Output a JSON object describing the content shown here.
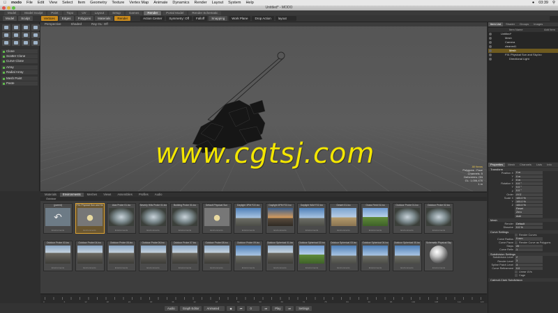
{
  "menubar": {
    "app": "modo",
    "items": [
      "File",
      "Edit",
      "View",
      "Select",
      "Item",
      "Geometry",
      "Texture",
      "Vertex Map",
      "Animate",
      "Dynamics",
      "Render",
      "Layout",
      "System",
      "Help"
    ],
    "clock": "03:39"
  },
  "window": {
    "title": "Untitled* - MODO"
  },
  "layout_tabs": [
    "Model",
    "Model Sculpt",
    "Paint",
    "Topo",
    "UV",
    "Layout",
    "Setup",
    "Games",
    "Render",
    "Portal Model",
    "Render Schematic"
  ],
  "layout_tab_active": "Render",
  "toolbar": {
    "model": "Model",
    "sculpt": "Sculpt",
    "vertices": "Vertices",
    "edges": "Edges",
    "polygons": "Polygons",
    "materials": "Materials",
    "render": "Render",
    "action_center": "Action Center",
    "symmetry": "Symmetry: Off",
    "falloff": "Falloff",
    "snapping": "Snapping",
    "work_plane": "Work Plane",
    "drop_action": "Drop Action",
    "layout": "layout"
  },
  "toolbox": {
    "group1": [
      "Clone",
      "Scatter Clone",
      "Curve Clone"
    ],
    "group2": [
      "Array",
      "Radial Array"
    ],
    "group3": [
      "Mesh Paint",
      "Paste"
    ]
  },
  "viewport": {
    "tabs": [
      "Perspective",
      "Shaded",
      "Ray GL: Off"
    ],
    "info": [
      "All Items",
      "Polygons : Face",
      "Channels: 5",
      "Deformers: ON",
      "GL: 1,006,476",
      "1 m"
    ],
    "watermark": "www.cgtsj.com"
  },
  "items_panel": {
    "tabs": [
      "Item List",
      "Shader",
      "Groups",
      "Images"
    ],
    "header_left": "Item Name",
    "header_right": "Add Item",
    "rows": [
      {
        "label": "Untitled*",
        "indent": 18,
        "sel": false
      },
      {
        "label": "Mesh",
        "indent": 24,
        "sel": false
      },
      {
        "label": "Camera",
        "indent": 24,
        "sel": false
      },
      {
        "label": "cleaned1",
        "indent": 24,
        "sel": false
      },
      {
        "label": "Mesh",
        "indent": 30,
        "sel": true
      },
      {
        "label": "F51 Physical Sun and Sky.lxo",
        "indent": 24,
        "sel": false
      },
      {
        "label": "Directional Light",
        "indent": 30,
        "sel": false
      }
    ]
  },
  "properties": {
    "tabs": [
      "Properties",
      "Mesh",
      "Channels",
      "Lists",
      "Info"
    ],
    "transform": "Transform",
    "rows": [
      {
        "label": "Position X",
        "value": "0 m"
      },
      {
        "label": "Y",
        "value": "0 m"
      },
      {
        "label": "Z",
        "value": "0 m"
      },
      {
        "label": "Rotation X",
        "value": "0.0 °"
      },
      {
        "label": "Y",
        "value": "0.0 °"
      },
      {
        "label": "Z",
        "value": "0.0 °"
      },
      {
        "label": "Order",
        "value": "XYZ"
      },
      {
        "label": "Scale X",
        "value": "100.0 %"
      },
      {
        "label": "Y",
        "value": "100.0 %"
      },
      {
        "label": "Z",
        "value": "100.0 %"
      },
      {
        "label": "",
        "value": "Reset"
      },
      {
        "label": "",
        "value": "Zero"
      },
      {
        "label": "",
        "value": "Add"
      }
    ],
    "mesh": "Mesh",
    "mesh_rows": [
      {
        "label": "Render",
        "value": "Default"
      },
      {
        "label": "Dissolve",
        "value": "0.0 %"
      }
    ],
    "curve_settings": "Curve Settings",
    "curve_rows": [
      {
        "label": "",
        "value": "Render Curves",
        "check": true
      },
      {
        "label": "Curve Radius",
        "value": "5 mm"
      },
      {
        "label": "Curve Pacm",
        "value": "Render Curve as Polygons",
        "check": true
      },
      {
        "label": "Steps",
        "value": "20"
      },
      {
        "label": "Curve Refin",
        "value": "1"
      }
    ],
    "subdivision": "Subdivision Settings",
    "subdiv_rows": [
      {
        "label": "Subdivision Level",
        "value": "2"
      },
      {
        "label": "Render Level",
        "value": "3"
      },
      {
        "label": "Spline Patch Level",
        "value": "3"
      },
      {
        "label": "Curve Refinement",
        "value": "0.0"
      },
      {
        "label": "",
        "value": "Linear UVs",
        "check": true
      },
      {
        "label": "",
        "value": "Cage",
        "check": true
      }
    ],
    "catmull": "Catmull-Clark Subdivision"
  },
  "browser": {
    "tabs": [
      "Materials",
      "Environments",
      "Meshes",
      "Views",
      "Assemblies",
      "Profiles",
      "Audio"
    ],
    "active_tab": "Environments",
    "path": "Outdoor",
    "thumbs": [
      {
        "label": "(parent)",
        "kind": "parent",
        "foot": "Environments"
      },
      {
        "label": "F51 Physical Sun and Sk",
        "kind": "light",
        "foot": "Environments",
        "sel": true
      },
      {
        "label": "Alva Probe 01.lxo",
        "kind": "sphere",
        "foot": "Environments"
      },
      {
        "label": "Beverly Hills Probe 01.lxo",
        "kind": "sphere",
        "foot": "Environments"
      },
      {
        "label": "Building Probe 01.lxo",
        "kind": "sphere",
        "foot": "Environments"
      },
      {
        "label": "Default Physical Sun",
        "kind": "light",
        "foot": "Environments"
      },
      {
        "label": "Daylight 3PM F22.lxo",
        "kind": "sky",
        "foot": "Environments"
      },
      {
        "label": "Daylight 6PM F22.lxo",
        "kind": "sunset",
        "foot": "Environments"
      },
      {
        "label": "Daylight 9AM F22.lxo",
        "kind": "sky",
        "foot": "Environments"
      },
      {
        "label": "Desert 01.lxo",
        "kind": "desert",
        "foot": "Environments"
      },
      {
        "label": "Grass Field 01.lxo",
        "kind": "grass",
        "foot": "Environments"
      },
      {
        "label": "Outdoor Probe 01.lxo",
        "kind": "sphere",
        "foot": "Environments"
      },
      {
        "label": "Outdoor Probe 02.lxo",
        "kind": "sphere",
        "foot": "Environments"
      },
      {
        "label": "Outdoor Probe 03.lxo",
        "kind": "street",
        "foot": "Environments"
      },
      {
        "label": "Outdoor Probe 04.lxo",
        "kind": "street",
        "foot": "Environments"
      },
      {
        "label": "Outdoor Probe 05.lxo",
        "kind": "street",
        "foot": "Environments"
      },
      {
        "label": "Outdoor Probe 06.lxo",
        "kind": "street",
        "foot": "Environments"
      },
      {
        "label": "Outdoor Probe 07.lxo",
        "kind": "street",
        "foot": "Environments"
      },
      {
        "label": "Outdoor Probe 08.lxo",
        "kind": "street",
        "foot": "Environments"
      },
      {
        "label": "Outdoor Probe 09.lxo",
        "kind": "sky",
        "foot": "Environments"
      },
      {
        "label": "Outdoor Spherical 01.lxo",
        "kind": "street",
        "foot": "Environments"
      },
      {
        "label": "Outdoor Spherical 02.lxo",
        "kind": "grass",
        "foot": "Environments"
      },
      {
        "label": "Outdoor Spherical 03.lxo",
        "kind": "sky",
        "foot": "Environments"
      },
      {
        "label": "Outdoor Spherical 04.lxo",
        "kind": "sky",
        "foot": "Environments"
      },
      {
        "label": "Outdoor Spherical 05.lxo",
        "kind": "sky",
        "foot": "Environments"
      },
      {
        "label": "Schematic Physical Sky",
        "kind": "ball",
        "foot": "Environments"
      }
    ]
  },
  "timeline": {
    "ticks": [
      "0",
      "6",
      "12",
      "18",
      "24",
      "30",
      "36",
      "42",
      "48",
      "54",
      "60",
      "66",
      "72",
      "78",
      "84",
      "90",
      "96",
      "102",
      "108",
      "114",
      "120"
    ]
  },
  "bottombar": {
    "audio": "Audio",
    "graph_editor": "Graph Editor",
    "animated": "Animated",
    "frame": "0",
    "play": "Play",
    "settings": "Settings"
  },
  "colors": {
    "accent": "#c98a1c",
    "selection": "#e0a533",
    "watermark": "#f3e600"
  }
}
